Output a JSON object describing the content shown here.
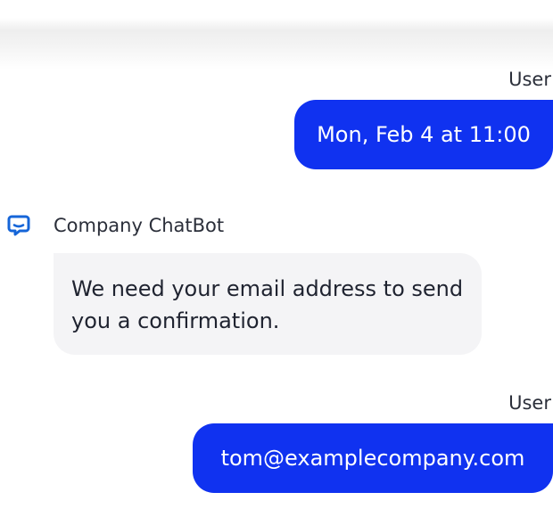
{
  "messages": [
    {
      "sender": "User",
      "text": "Mon, Feb 4 at 11:00"
    },
    {
      "sender": "Company ChatBot",
      "text": "We need your email address to send you a confirmation.",
      "icon": "chat-bubble-icon"
    },
    {
      "sender": "User",
      "text": "tom@examplecompany.com"
    }
  ],
  "colors": {
    "user_bubble": "#1032f0",
    "bot_bubble": "#f4f4f6",
    "bot_icon": "#1565d8"
  }
}
